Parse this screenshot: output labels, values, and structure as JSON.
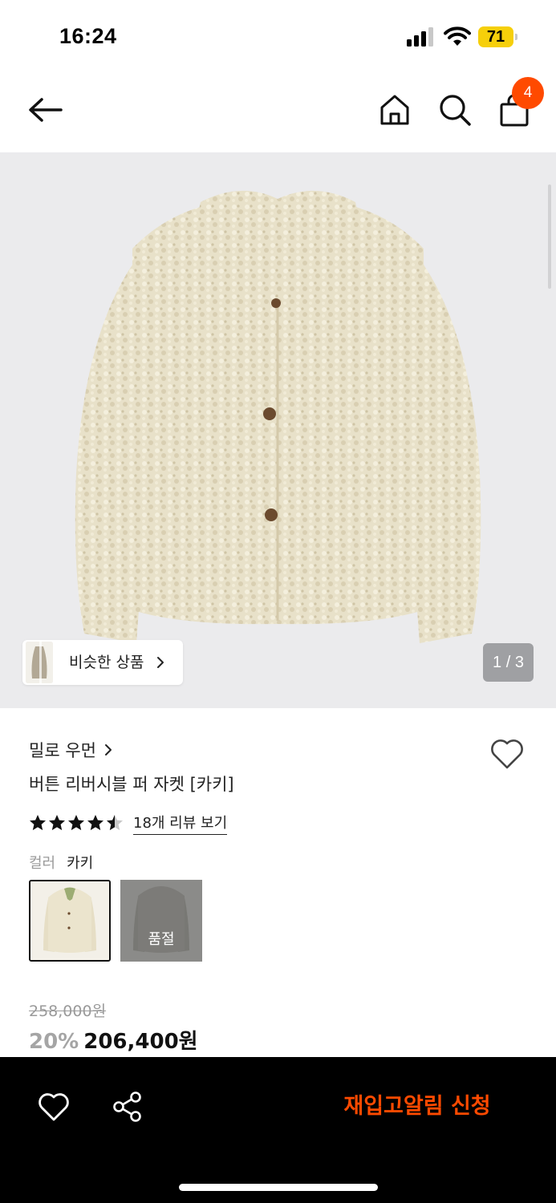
{
  "status_bar": {
    "time": "16:24",
    "battery": "71"
  },
  "header": {
    "cart_count": "4"
  },
  "gallery": {
    "similar_label": "비슷한 상품",
    "counter": "1 / 3"
  },
  "product": {
    "brand": "밀로 우먼",
    "title": "버튼 리버시블 퍼 자켓 [카키]",
    "rating": 4.5,
    "review_link": "18개 리뷰 보기",
    "color_label": "컬러",
    "color_value": "카키",
    "swatches": [
      {
        "name": "ivory",
        "sold_out": false
      },
      {
        "name": "gray",
        "sold_out": true,
        "label": "품절"
      }
    ],
    "original_price": "258,000원",
    "discount": "20%",
    "sale_price": "206,400원"
  },
  "bottom_bar": {
    "restock_label": "재입고알림 신청"
  },
  "colors": {
    "accent": "#ff4a00",
    "image_bg": "#ebebed",
    "coat": "#e6dfc6"
  }
}
